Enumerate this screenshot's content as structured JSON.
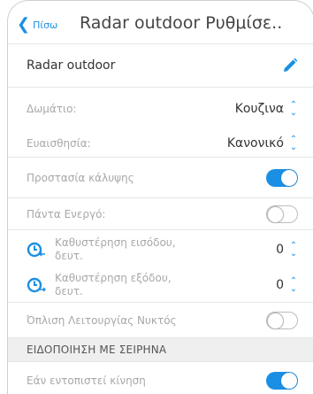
{
  "header": {
    "back_label": "Πίσω",
    "title": "Radar outdoor Ρυθμίσε.."
  },
  "device_name": "Radar outdoor",
  "room": {
    "label": "Δωμάτιο:",
    "value": "Κουζινα"
  },
  "sensitivity": {
    "label": "Ευαισθησία:",
    "value": "Κανονικό"
  },
  "cover_protection": {
    "label": "Προστασία κάλυψης",
    "on": true
  },
  "always_on": {
    "label": "Πάντα Ενεργό:",
    "on": false
  },
  "entry_delay": {
    "label_line1": "Καθυστέρηση εισόδου,",
    "label_line2": "δευτ.",
    "value": "0"
  },
  "exit_delay": {
    "label_line1": "Καθυστέρηση εξόδου,",
    "label_line2": "δευτ.",
    "value": "0"
  },
  "night_mode": {
    "label": "Όπλιση Λειτουργίας Νυκτός",
    "on": false
  },
  "siren_section": {
    "title": "ΕΙΔΟΠΟΙΗΣΗ ΜΕ ΣΕΙΡΗΝΑ"
  },
  "motion_detected": {
    "label": "Εάν εντοπιστεί κίνηση",
    "on": true
  },
  "colors": {
    "accent": "#1a8fe3",
    "muted_text": "#a8a8a8",
    "section_bg": "#efefef"
  }
}
